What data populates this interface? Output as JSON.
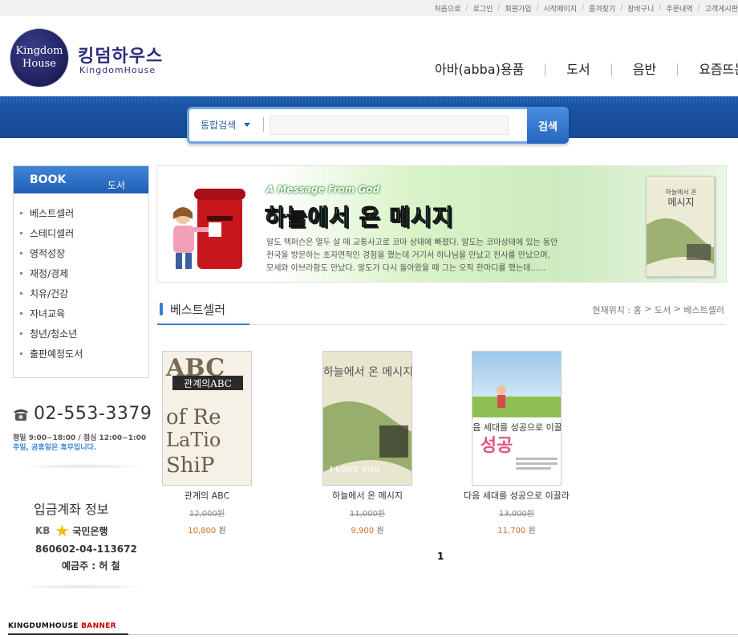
{
  "topbar": {
    "links": [
      "처음으로",
      "로그인",
      "회원가입",
      "시작페이지",
      "즐겨찾기",
      "장바구니",
      "주문내역",
      "고객게시판"
    ]
  },
  "header": {
    "logo_line1": "Kingdom",
    "logo_line2": "House",
    "logo_ko": "킹덤하우스",
    "logo_en": "KingdomHouse",
    "nav": [
      "아바(abba)용품",
      "도서",
      "음반",
      "요즘뜨는책"
    ]
  },
  "search": {
    "scope": "통합검색",
    "placeholder": "",
    "value": "",
    "button": "검색"
  },
  "sidebar": {
    "title_en": "BOOK",
    "title_ko": "도서",
    "items": [
      "베스트셀러",
      "스테디셀러",
      "영적성장",
      "재정/경제",
      "치유/건강",
      "자녀교육",
      "청년/청소년",
      "출판예정도서"
    ],
    "phone": "02-553-3379",
    "hours": "평일 9:00~18:00 / 점심 12:00~1:00",
    "holiday": "주일, 공휴일은 휴무입니다.",
    "account_title": "입금계좌 정보",
    "bank_kb": "KB",
    "bank_name": "국민은행",
    "account_number": "860602-04-113672",
    "account_owner": "예금주 : 허 철"
  },
  "promo": {
    "eyebrow": "A Message From God",
    "title": "하늘에서 온 메시지",
    "lines": [
      "알도 맥퍼슨은 열두 살 때 교통사고로 코마 상태에 빠졌다. 알도는 코마상태에 있는 동안",
      "천국을 방문하는 초자연적인 경험을 했는데 거기서 하나님을 만났고 천사를 만났으며,",
      "모세와 아브라함도 만났다.  알도가 다시 돌아왔을 때 그는 오직 한마디를 했는데......"
    ]
  },
  "section": {
    "title": "베스트셀러",
    "breadcrumb": [
      "현재위치 : 홈",
      "도서",
      "베스트셀러"
    ]
  },
  "products": [
    {
      "name": "관계의 ABC",
      "original_price": "12,000원",
      "sale_price": "10,800",
      "won": "원",
      "cover_title": "관계의ABC"
    },
    {
      "name": "하늘에서 온 메시지",
      "original_price": "11,000원",
      "sale_price": "9,900",
      "won": "원",
      "cover_title": "하늘에서 온 메시지"
    },
    {
      "name": "다음 세대를 성공으로 이끌라",
      "original_price": "13,000원",
      "sale_price": "11,700",
      "won": "원",
      "cover_title": "다음 세대를 성공으로 이끌라"
    }
  ],
  "pagination": {
    "current": "1"
  },
  "banner": {
    "title_black": "KINGDUMHOUSE",
    "title_red": "BANNER"
  },
  "colors": {
    "accent_blue": "#1f5fb6",
    "sale_orange": "#d86a1a",
    "promo_green": "#cdebbf"
  }
}
